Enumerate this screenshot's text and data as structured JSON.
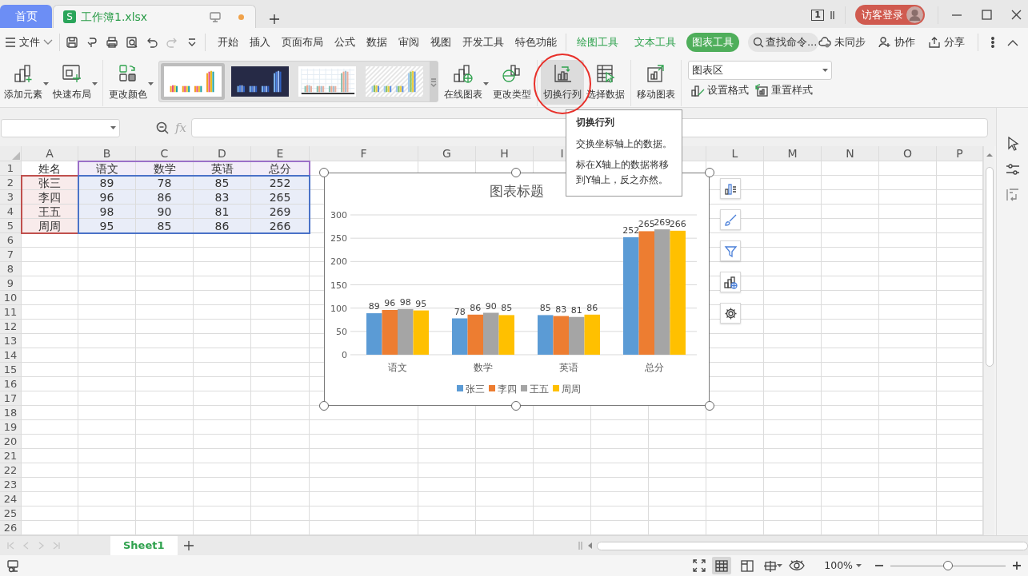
{
  "tabs": [
    {
      "kind": "home",
      "label": "首页",
      "selected": false
    },
    {
      "kind": "document",
      "badge": "S",
      "label": "工作簿1.xlsx",
      "unsaved": true,
      "selected": true
    }
  ],
  "window": {
    "count": "1",
    "login": "访客登录"
  },
  "menu": {
    "file": "文件",
    "quick_access": [
      {
        "kind": "save",
        "disabled": false
      },
      {
        "kind": "painter",
        "disabled": false
      },
      {
        "kind": "print",
        "disabled": false
      },
      {
        "kind": "preview",
        "disabled": false
      },
      {
        "kind": "undo",
        "disabled": false
      },
      {
        "kind": "redo",
        "disabled": true
      },
      {
        "kind": "more",
        "disabled": false
      }
    ],
    "items": [
      {
        "label": "开始",
        "kind": "main",
        "selected": false
      },
      {
        "label": "插入",
        "kind": "main",
        "selected": false
      },
      {
        "label": "页面布局",
        "kind": "main",
        "selected": false
      },
      {
        "label": "公式",
        "kind": "main",
        "selected": false
      },
      {
        "label": "数据",
        "kind": "main",
        "selected": false
      },
      {
        "label": "审阅",
        "kind": "main",
        "selected": false
      },
      {
        "label": "视图",
        "kind": "main",
        "selected": false
      },
      {
        "label": "开发工具",
        "kind": "main",
        "selected": false
      },
      {
        "label": "特色功能",
        "kind": "main",
        "selected": false
      },
      {
        "label": "绘图工具",
        "kind": "context",
        "selected": false
      },
      {
        "label": "文本工具",
        "kind": "context",
        "selected": false
      },
      {
        "label": "图表工具",
        "kind": "context",
        "selected": true
      }
    ],
    "search": {
      "placeholder": "查找命令..."
    },
    "actions": [
      {
        "kind": "sync",
        "label": "未同步"
      },
      {
        "kind": "collab",
        "label": "协作"
      },
      {
        "kind": "share",
        "label": "分享"
      }
    ]
  },
  "ribbon": {
    "groups": [
      {
        "kind": "large",
        "items": [
          {
            "kind": "add",
            "label": "添加元素",
            "dropdown": true,
            "hover": false,
            "circled": false
          },
          {
            "kind": "layout",
            "label": "快速布局",
            "dropdown": true,
            "hover": false,
            "circled": false
          }
        ]
      },
      {
        "kind": "large",
        "items": [
          {
            "kind": "color",
            "label": "更改颜色",
            "dropdown": true,
            "hover": false,
            "circled": false
          },
          {
            "kind": "gallery",
            "styles": [
              {
                "kind": "light",
                "selected": true
              },
              {
                "kind": "dark",
                "selected": false
              },
              {
                "kind": "grid",
                "selected": false
              },
              {
                "kind": "striped",
                "selected": false
              }
            ]
          },
          {
            "kind": "online",
            "label": "在线图表",
            "dropdown": true,
            "hover": false,
            "circled": false
          },
          {
            "kind": "type",
            "label": "更改类型",
            "dropdown": false,
            "hover": false,
            "circled": false
          }
        ]
      },
      {
        "kind": "large",
        "items": [
          {
            "kind": "switch",
            "label": "切换行列",
            "dropdown": false,
            "hover": true,
            "circled": true
          },
          {
            "kind": "select",
            "label": "选择数据",
            "dropdown": false,
            "hover": false,
            "circled": false
          }
        ]
      },
      {
        "kind": "large",
        "items": [
          {
            "kind": "move",
            "label": "移动图表",
            "dropdown": false,
            "hover": false,
            "circled": false
          }
        ]
      },
      {
        "kind": "compact",
        "picker": "图表区",
        "items": [
          {
            "kind": "format",
            "label": "设置格式"
          },
          {
            "kind": "reset",
            "label": "重置样式"
          }
        ]
      }
    ]
  },
  "formula_bar": {
    "fx": "fx"
  },
  "sheet": {
    "columns": [
      "A",
      "B",
      "C",
      "D",
      "E",
      "F",
      "G",
      "H",
      "I",
      null,
      null,
      "L",
      "M",
      "N",
      "O",
      "P"
    ],
    "row_numbers": [
      "1",
      "2",
      "3",
      "4",
      "5",
      "6",
      "7",
      "8",
      "9",
      "10",
      "11",
      "12",
      "13",
      "14",
      "15",
      "16",
      "17",
      "18",
      "19",
      "20",
      "21",
      "22",
      "23",
      "24",
      "25",
      "26"
    ],
    "rows": [
      [
        "姓名",
        "语文",
        "数学",
        "英语",
        "总分"
      ],
      [
        "张三",
        "89",
        "78",
        "85",
        "252"
      ],
      [
        "李四",
        "96",
        "86",
        "83",
        "265"
      ],
      [
        "王五",
        "98",
        "90",
        "81",
        "269"
      ],
      [
        "周周",
        "95",
        "85",
        "86",
        "266"
      ]
    ],
    "chart_selected": true
  },
  "chart": {
    "chart_data": {
      "type": "bar",
      "title": "图表标题",
      "categories": [
        "语文",
        "数学",
        "英语",
        "总分"
      ],
      "series": [
        {
          "name": "张三",
          "color": "#5b9bd5",
          "values": [
            89,
            78,
            85,
            252
          ]
        },
        {
          "name": "李四",
          "color": "#ed7d31",
          "values": [
            96,
            86,
            83,
            265
          ]
        },
        {
          "name": "王五",
          "color": "#a5a5a5",
          "values": [
            98,
            90,
            81,
            269
          ]
        },
        {
          "name": "周周",
          "color": "#ffc000",
          "values": [
            95,
            85,
            86,
            266
          ]
        }
      ],
      "ylim": [
        0,
        300
      ],
      "yticks": [
        0,
        50,
        100,
        150,
        200,
        250,
        300
      ],
      "data_labels": true,
      "grid": true,
      "legend": "bottom"
    },
    "tools": [
      {
        "kind": "elements"
      },
      {
        "kind": "style"
      },
      {
        "kind": "filter"
      },
      {
        "kind": "online"
      },
      {
        "kind": "settings"
      }
    ]
  },
  "tooltip": {
    "title": "切换行列",
    "paragraphs": [
      "交换坐标轴上的数据。",
      "标在X轴上的数据将移到Y轴上，反之亦然。"
    ]
  },
  "sheet_nav": {
    "disabled": true
  },
  "sheet_tabs": [
    {
      "label": "Sheet1",
      "selected": true
    }
  ],
  "status_bar": {
    "views": [
      {
        "kind": "normal",
        "selected": true
      },
      {
        "kind": "page",
        "selected": false
      },
      {
        "kind": "break",
        "selected": false
      }
    ],
    "zoom": "100%",
    "zoom_slider": {
      "level": 0.5
    }
  }
}
